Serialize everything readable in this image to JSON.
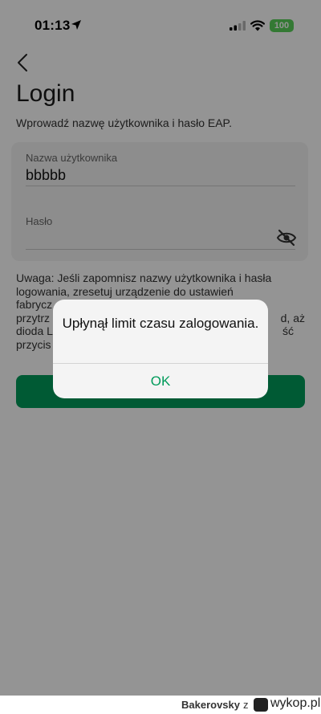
{
  "status_bar": {
    "time": "01:13",
    "battery": "100"
  },
  "page": {
    "title": "Login",
    "subtitle": "Wprowadź nazwę użytkownika i hasło EAP."
  },
  "form": {
    "username_label": "Nazwa użytkownika",
    "username_value": "bbbbb",
    "password_label": "Hasło",
    "password_value": ""
  },
  "note": {
    "line1": "Uwaga: Jeśli zapomnisz nazwy użytkownika i hasła",
    "line2": "logowania, zresetuj urządzenie do ustawień",
    "line3": "fabrycz",
    "line4_left": "przytrz",
    "line4_right": "d, aż",
    "line5_left": "dioda L",
    "line5_right": "ść",
    "line6": "przycis"
  },
  "login_button": {
    "label": ""
  },
  "alert": {
    "message": "Upłynął limit czasu zalogowania.",
    "ok_label": "OK"
  },
  "footer": {
    "user": "Bakerovsky",
    "separator": "z",
    "site": "wykop.pl"
  },
  "colors": {
    "accent": "#009b5a",
    "battery": "#5bd15b",
    "overlay": "rgba(0,0,0,0.42)"
  }
}
